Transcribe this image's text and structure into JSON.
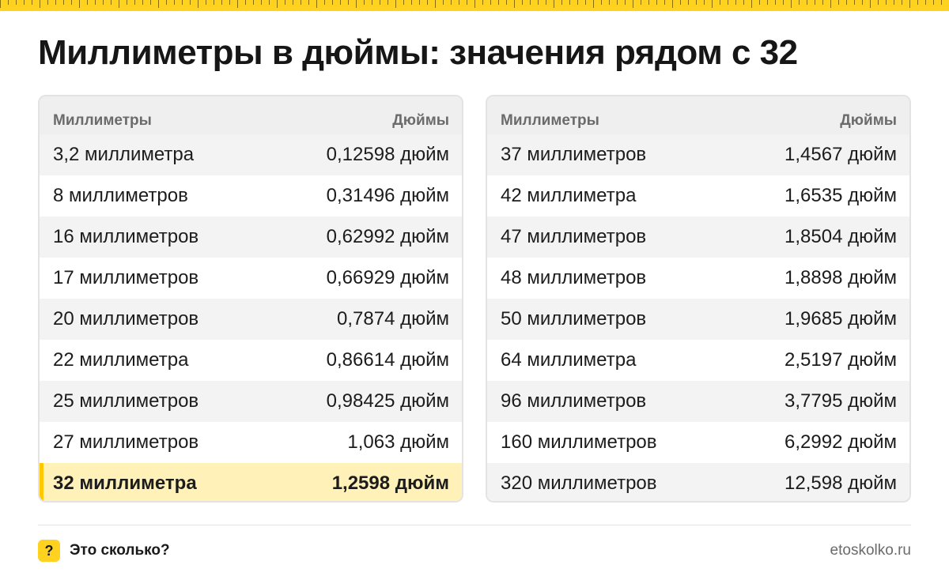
{
  "title": "Миллиметры в дюймы: значения рядом с 32",
  "left_table": {
    "header": {
      "mm": "Миллиметры",
      "in": "Дюймы"
    },
    "rows": [
      {
        "mm": "3,2 миллиметра",
        "in": "0,12598 дюйм"
      },
      {
        "mm": "8 миллиметров",
        "in": "0,31496 дюйм"
      },
      {
        "mm": "16 миллиметров",
        "in": "0,62992 дюйм"
      },
      {
        "mm": "17 миллиметров",
        "in": "0,66929 дюйм"
      },
      {
        "mm": "20 миллиметров",
        "in": "0,7874 дюйм"
      },
      {
        "mm": "22 миллиметра",
        "in": "0,86614 дюйм"
      },
      {
        "mm": "25 миллиметров",
        "in": "0,98425 дюйм"
      },
      {
        "mm": "27 миллиметров",
        "in": "1,063 дюйм"
      },
      {
        "mm": "32 миллиметра",
        "in": "1,2598 дюйм"
      }
    ],
    "highlighted_row_index": 8
  },
  "right_table": {
    "header": {
      "mm": "Миллиметры",
      "in": "Дюймы"
    },
    "rows": [
      {
        "mm": "37 миллиметров",
        "in": "1,4567 дюйм"
      },
      {
        "mm": "42 миллиметра",
        "in": "1,6535 дюйм"
      },
      {
        "mm": "47 миллиметров",
        "in": "1,8504 дюйм"
      },
      {
        "mm": "48 миллиметров",
        "in": "1,8898 дюйм"
      },
      {
        "mm": "50 миллиметров",
        "in": "1,9685 дюйм"
      },
      {
        "mm": "64 миллиметра",
        "in": "2,5197 дюйм"
      },
      {
        "mm": "96 миллиметров",
        "in": "3,7795 дюйм"
      },
      {
        "mm": "160 миллиметров",
        "in": "6,2992 дюйм"
      },
      {
        "mm": "320 миллиметров",
        "in": "12,598 дюйм"
      }
    ]
  },
  "footer": {
    "badge": "?",
    "brand": "Это сколько?",
    "site": "etoskolko.ru"
  },
  "colors": {
    "accent": "#ffd21f",
    "highlight_bg": "#fff1b8",
    "highlight_bar": "#ffc800"
  }
}
